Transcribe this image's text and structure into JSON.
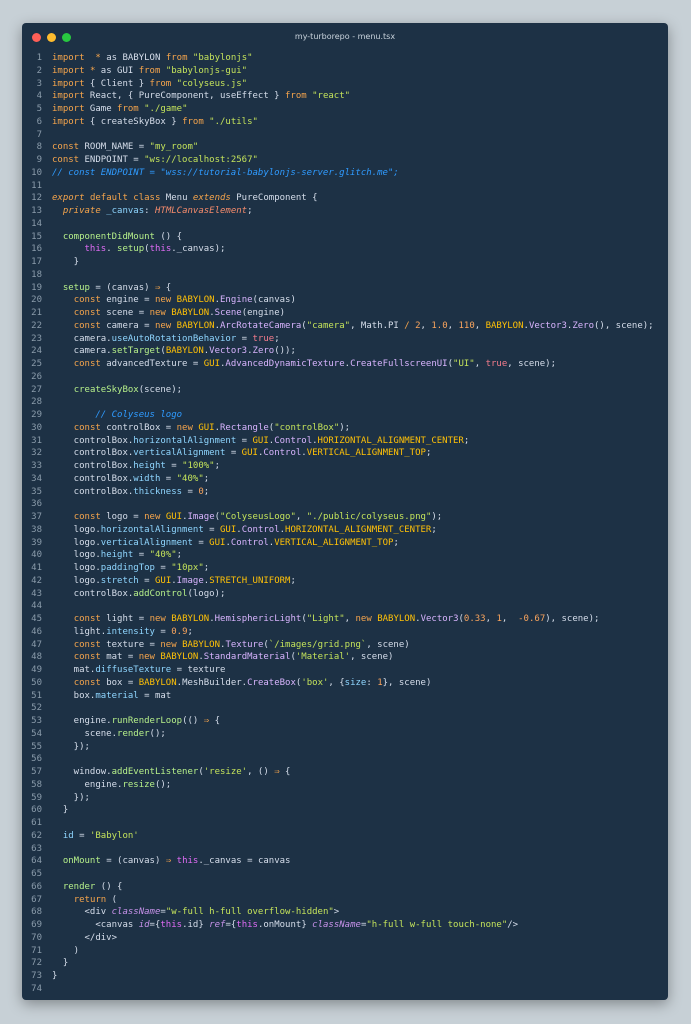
{
  "window": {
    "title": "my-turborepo - menu.tsx",
    "traffic_lights": [
      "close-button",
      "minimize-button",
      "maximize-button"
    ]
  },
  "code_lines": [
    [
      [
        "kw",
        "import"
      ],
      [
        "",
        "  "
      ],
      [
        "kw",
        "*"
      ],
      [
        "",
        " as BABYLON "
      ],
      [
        "kw",
        "from"
      ],
      [
        "",
        " "
      ],
      [
        "str",
        "\"babylonjs\""
      ]
    ],
    [
      [
        "kw",
        "import"
      ],
      [
        "",
        " "
      ],
      [
        "kw",
        "*"
      ],
      [
        "",
        " as GUI "
      ],
      [
        "kw",
        "from"
      ],
      [
        "",
        " "
      ],
      [
        "str",
        "\"babylonjs-gui\""
      ]
    ],
    [
      [
        "kw",
        "import"
      ],
      [
        "",
        " { Client } "
      ],
      [
        "kw",
        "from"
      ],
      [
        "",
        " "
      ],
      [
        "str",
        "\"colyseus.js\""
      ]
    ],
    [
      [
        "kw",
        "import"
      ],
      [
        "",
        " React, { PureComponent, useEffect } "
      ],
      [
        "kw",
        "from"
      ],
      [
        "",
        " "
      ],
      [
        "str",
        "\"react\""
      ]
    ],
    [
      [
        "kw",
        "import"
      ],
      [
        "",
        " Game "
      ],
      [
        "kw",
        "from"
      ],
      [
        "",
        " "
      ],
      [
        "str",
        "\"./game\""
      ]
    ],
    [
      [
        "kw",
        "import"
      ],
      [
        "",
        " { createSkyBox } "
      ],
      [
        "kw",
        "from"
      ],
      [
        "",
        " "
      ],
      [
        "str",
        "\"./utils\""
      ]
    ],
    [],
    [
      [
        "kw",
        "const"
      ],
      [
        "",
        " ROOM_NAME = "
      ],
      [
        "str",
        "\"my_room\""
      ]
    ],
    [
      [
        "kw",
        "const"
      ],
      [
        "",
        " ENDPOINT = "
      ],
      [
        "str",
        "\"ws://localhost:2567\""
      ]
    ],
    [
      [
        "cm",
        "// const ENDPOINT = \"wss://tutorial-babylonjs-server.glitch.me\";"
      ]
    ],
    [],
    [
      [
        "kwi",
        "export"
      ],
      [
        "",
        " "
      ],
      [
        "kw",
        "default"
      ],
      [
        "",
        " "
      ],
      [
        "kw",
        "class"
      ],
      [
        "",
        " Menu "
      ],
      [
        "kwi",
        "extends"
      ],
      [
        "",
        " PureComponent {"
      ]
    ],
    [
      [
        "",
        "  "
      ],
      [
        "kwi",
        "private"
      ],
      [
        "",
        " "
      ],
      [
        "prop",
        "_canvas"
      ],
      [
        "",
        ": "
      ],
      [
        "ty",
        "HTMLCanvasElement"
      ],
      [
        "",
        ";"
      ]
    ],
    [],
    [
      [
        "",
        "  "
      ],
      [
        "mth",
        "componentDidMount"
      ],
      [
        "",
        " () {"
      ]
    ],
    [
      [
        "",
        "      "
      ],
      [
        "this",
        "this"
      ],
      [
        "",
        ". "
      ],
      [
        "mth",
        "setup"
      ],
      [
        "",
        "("
      ],
      [
        "this",
        "this"
      ],
      [
        "",
        "._canvas);"
      ]
    ],
    [
      [
        "",
        "    }"
      ]
    ],
    [],
    [
      [
        "",
        "  "
      ],
      [
        "mth",
        "setup"
      ],
      [
        "",
        " = (canvas) "
      ],
      [
        "kw",
        "⇒"
      ],
      [
        "",
        " {"
      ]
    ],
    [
      [
        "",
        "    "
      ],
      [
        "kw",
        "const"
      ],
      [
        "",
        " engine = "
      ],
      [
        "kw",
        "new"
      ],
      [
        "",
        " "
      ],
      [
        "cls",
        "BABYLON"
      ],
      [
        "",
        "."
      ],
      [
        "fn",
        "Engine"
      ],
      [
        "",
        "(canvas)"
      ]
    ],
    [
      [
        "",
        "    "
      ],
      [
        "kw",
        "const"
      ],
      [
        "",
        " scene = "
      ],
      [
        "kw",
        "new"
      ],
      [
        "",
        " "
      ],
      [
        "cls",
        "BABYLON"
      ],
      [
        "",
        "."
      ],
      [
        "fn",
        "Scene"
      ],
      [
        "",
        "(engine)"
      ]
    ],
    [
      [
        "",
        "    "
      ],
      [
        "kw",
        "const"
      ],
      [
        "",
        " camera = "
      ],
      [
        "kw",
        "new"
      ],
      [
        "",
        " "
      ],
      [
        "cls",
        "BABYLON"
      ],
      [
        "",
        "."
      ],
      [
        "fn",
        "ArcRotateCamera"
      ],
      [
        "",
        "("
      ],
      [
        "str",
        "\"camera\""
      ],
      [
        "",
        ", Math.PI "
      ],
      [
        "kw",
        "/"
      ],
      [
        "",
        " "
      ],
      [
        "num",
        "2"
      ],
      [
        "",
        ", "
      ],
      [
        "num",
        "1.0"
      ],
      [
        "",
        ", "
      ],
      [
        "num",
        "110"
      ],
      [
        "",
        ", "
      ],
      [
        "cls",
        "BABYLON"
      ],
      [
        "",
        "."
      ],
      [
        "fn",
        "Vector3"
      ],
      [
        "",
        "."
      ],
      [
        "fn",
        "Zero"
      ],
      [
        "",
        "(), scene);"
      ]
    ],
    [
      [
        "",
        "    camera."
      ],
      [
        "prop",
        "useAutoRotationBehavior"
      ],
      [
        "",
        " = "
      ],
      [
        "bool",
        "true"
      ],
      [
        "",
        ";"
      ]
    ],
    [
      [
        "",
        "    camera."
      ],
      [
        "mth",
        "setTarget"
      ],
      [
        "",
        "("
      ],
      [
        "cls",
        "BABYLON"
      ],
      [
        "",
        "."
      ],
      [
        "fn",
        "Vector3"
      ],
      [
        "",
        "."
      ],
      [
        "fn",
        "Zero"
      ],
      [
        "",
        "());"
      ]
    ],
    [
      [
        "",
        "    "
      ],
      [
        "kw",
        "const"
      ],
      [
        "",
        " advancedTexture = "
      ],
      [
        "cls",
        "GUI"
      ],
      [
        "",
        "."
      ],
      [
        "fn",
        "AdvancedDynamicTexture"
      ],
      [
        "",
        "."
      ],
      [
        "fn",
        "CreateFullscreenUI"
      ],
      [
        "",
        "("
      ],
      [
        "str",
        "\"UI\""
      ],
      [
        "",
        ", "
      ],
      [
        "bool",
        "true"
      ],
      [
        "",
        ", scene);"
      ]
    ],
    [],
    [
      [
        "",
        "    "
      ],
      [
        "mth",
        "createSkyBox"
      ],
      [
        "",
        "(scene);"
      ]
    ],
    [],
    [
      [
        "",
        "        "
      ],
      [
        "cm",
        "// Colyseus logo"
      ]
    ],
    [
      [
        "",
        "    "
      ],
      [
        "kw",
        "const"
      ],
      [
        "",
        " controlBox = "
      ],
      [
        "kw",
        "new"
      ],
      [
        "",
        " "
      ],
      [
        "cls",
        "GUI"
      ],
      [
        "",
        "."
      ],
      [
        "fn",
        "Rectangle"
      ],
      [
        "",
        "("
      ],
      [
        "str",
        "\"controlBox\""
      ],
      [
        "",
        ");"
      ]
    ],
    [
      [
        "",
        "    controlBox."
      ],
      [
        "prop",
        "horizontalAlignment"
      ],
      [
        "",
        " = "
      ],
      [
        "cls",
        "GUI"
      ],
      [
        "",
        "."
      ],
      [
        "fn",
        "Control"
      ],
      [
        "",
        "."
      ],
      [
        "cls",
        "HORIZONTAL_ALIGNMENT_CENTER"
      ],
      [
        "",
        ";"
      ]
    ],
    [
      [
        "",
        "    controlBox."
      ],
      [
        "prop",
        "verticalAlignment"
      ],
      [
        "",
        " = "
      ],
      [
        "cls",
        "GUI"
      ],
      [
        "",
        "."
      ],
      [
        "fn",
        "Control"
      ],
      [
        "",
        "."
      ],
      [
        "cls",
        "VERTICAL_ALIGNMENT_TOP"
      ],
      [
        "",
        ";"
      ]
    ],
    [
      [
        "",
        "    controlBox."
      ],
      [
        "prop",
        "height"
      ],
      [
        "",
        " = "
      ],
      [
        "str",
        "\"100%\""
      ],
      [
        "",
        ";"
      ]
    ],
    [
      [
        "",
        "    controlBox."
      ],
      [
        "prop",
        "width"
      ],
      [
        "",
        " = "
      ],
      [
        "str",
        "\"40%\""
      ],
      [
        "",
        ";"
      ]
    ],
    [
      [
        "",
        "    controlBox."
      ],
      [
        "prop",
        "thickness"
      ],
      [
        "",
        " = "
      ],
      [
        "num",
        "0"
      ],
      [
        "",
        ";"
      ]
    ],
    [],
    [
      [
        "",
        "    "
      ],
      [
        "kw",
        "const"
      ],
      [
        "",
        " logo = "
      ],
      [
        "kw",
        "new"
      ],
      [
        "",
        " "
      ],
      [
        "cls",
        "GUI"
      ],
      [
        "",
        "."
      ],
      [
        "fn",
        "Image"
      ],
      [
        "",
        "("
      ],
      [
        "str",
        "\"ColyseusLogo\""
      ],
      [
        "",
        ", "
      ],
      [
        "str",
        "\"./public/colyseus.png\""
      ],
      [
        "",
        ");"
      ]
    ],
    [
      [
        "",
        "    logo."
      ],
      [
        "prop",
        "horizontalAlignment"
      ],
      [
        "",
        " = "
      ],
      [
        "cls",
        "GUI"
      ],
      [
        "",
        "."
      ],
      [
        "fn",
        "Control"
      ],
      [
        "",
        "."
      ],
      [
        "cls",
        "HORIZONTAL_ALIGNMENT_CENTER"
      ],
      [
        "",
        ";"
      ]
    ],
    [
      [
        "",
        "    logo."
      ],
      [
        "prop",
        "verticalAlignment"
      ],
      [
        "",
        " = "
      ],
      [
        "cls",
        "GUI"
      ],
      [
        "",
        "."
      ],
      [
        "fn",
        "Control"
      ],
      [
        "",
        "."
      ],
      [
        "cls",
        "VERTICAL_ALIGNMENT_TOP"
      ],
      [
        "",
        ";"
      ]
    ],
    [
      [
        "",
        "    logo."
      ],
      [
        "prop",
        "height"
      ],
      [
        "",
        " = "
      ],
      [
        "str",
        "\"40%\""
      ],
      [
        "",
        ";"
      ]
    ],
    [
      [
        "",
        "    logo."
      ],
      [
        "prop",
        "paddingTop"
      ],
      [
        "",
        " = "
      ],
      [
        "str",
        "\"10px\""
      ],
      [
        "",
        ";"
      ]
    ],
    [
      [
        "",
        "    logo."
      ],
      [
        "prop",
        "stretch"
      ],
      [
        "",
        " = "
      ],
      [
        "cls",
        "GUI"
      ],
      [
        "",
        "."
      ],
      [
        "fn",
        "Image"
      ],
      [
        "",
        "."
      ],
      [
        "cls",
        "STRETCH_UNIFORM"
      ],
      [
        "",
        ";"
      ]
    ],
    [
      [
        "",
        "    controlBox."
      ],
      [
        "mth",
        "addControl"
      ],
      [
        "",
        "(logo);"
      ]
    ],
    [],
    [
      [
        "",
        "    "
      ],
      [
        "kw",
        "const"
      ],
      [
        "",
        " light = "
      ],
      [
        "kw",
        "new"
      ],
      [
        "",
        " "
      ],
      [
        "cls",
        "BABYLON"
      ],
      [
        "",
        "."
      ],
      [
        "fn",
        "HemisphericLight"
      ],
      [
        "",
        "("
      ],
      [
        "str",
        "\"Light\""
      ],
      [
        "",
        ", "
      ],
      [
        "kw",
        "new"
      ],
      [
        "",
        " "
      ],
      [
        "cls",
        "BABYLON"
      ],
      [
        "",
        "."
      ],
      [
        "fn",
        "Vector3"
      ],
      [
        "",
        "("
      ],
      [
        "num",
        "0.33"
      ],
      [
        "",
        ", "
      ],
      [
        "num",
        "1"
      ],
      [
        "",
        ",  "
      ],
      [
        "num",
        "-0.67"
      ],
      [
        "",
        "), scene);"
      ]
    ],
    [
      [
        "",
        "    light."
      ],
      [
        "prop",
        "intensity"
      ],
      [
        "",
        " = "
      ],
      [
        "num",
        "0.9"
      ],
      [
        "",
        ";"
      ]
    ],
    [
      [
        "",
        "    "
      ],
      [
        "kw",
        "const"
      ],
      [
        "",
        " texture = "
      ],
      [
        "kw",
        "new"
      ],
      [
        "",
        " "
      ],
      [
        "cls",
        "BABYLON"
      ],
      [
        "",
        "."
      ],
      [
        "fn",
        "Texture"
      ],
      [
        "",
        "("
      ],
      [
        "str",
        "`/images/grid.png`"
      ],
      [
        "",
        ", scene)"
      ]
    ],
    [
      [
        "",
        "    "
      ],
      [
        "kw",
        "const"
      ],
      [
        "",
        " mat = "
      ],
      [
        "kw",
        "new"
      ],
      [
        "",
        " "
      ],
      [
        "cls",
        "BABYLON"
      ],
      [
        "",
        "."
      ],
      [
        "fn",
        "StandardMaterial"
      ],
      [
        "",
        "("
      ],
      [
        "str",
        "'Material'"
      ],
      [
        "",
        ", scene)"
      ]
    ],
    [
      [
        "",
        "    mat."
      ],
      [
        "prop",
        "diffuseTexture"
      ],
      [
        "",
        " = texture"
      ]
    ],
    [
      [
        "",
        "    "
      ],
      [
        "kw",
        "const"
      ],
      [
        "",
        " box = "
      ],
      [
        "cls",
        "BABYLON"
      ],
      [
        "",
        ".MeshBuilder."
      ],
      [
        "fn",
        "CreateBox"
      ],
      [
        "",
        "("
      ],
      [
        "str",
        "'box'"
      ],
      [
        "",
        ", {"
      ],
      [
        "prop",
        "size"
      ],
      [
        "",
        ": "
      ],
      [
        "num",
        "1"
      ],
      [
        "",
        "}, scene)"
      ]
    ],
    [
      [
        "",
        "    box."
      ],
      [
        "prop",
        "material"
      ],
      [
        "",
        " = mat"
      ]
    ],
    [],
    [
      [
        "",
        "    engine."
      ],
      [
        "mth",
        "runRenderLoop"
      ],
      [
        "",
        "(() "
      ],
      [
        "kw",
        "⇒"
      ],
      [
        "",
        " {"
      ]
    ],
    [
      [
        "",
        "      scene."
      ],
      [
        "mth",
        "render"
      ],
      [
        "",
        "();"
      ]
    ],
    [
      [
        "",
        "    });"
      ]
    ],
    [],
    [
      [
        "",
        "    window."
      ],
      [
        "mth",
        "addEventListener"
      ],
      [
        "",
        "("
      ],
      [
        "str",
        "'resize'"
      ],
      [
        "",
        ", () "
      ],
      [
        "kw",
        "⇒"
      ],
      [
        "",
        " {"
      ]
    ],
    [
      [
        "",
        "      engine."
      ],
      [
        "mth",
        "resize"
      ],
      [
        "",
        "();"
      ]
    ],
    [
      [
        "",
        "    });"
      ]
    ],
    [
      [
        "",
        "  }"
      ]
    ],
    [],
    [
      [
        "",
        "  "
      ],
      [
        "prop",
        "id"
      ],
      [
        "",
        " = "
      ],
      [
        "str",
        "'Babylon'"
      ]
    ],
    [],
    [
      [
        "",
        "  "
      ],
      [
        "mth",
        "onMount"
      ],
      [
        "",
        " = (canvas) "
      ],
      [
        "kw",
        "⇒"
      ],
      [
        "",
        " "
      ],
      [
        "this",
        "this"
      ],
      [
        "",
        "._canvas = canvas"
      ]
    ],
    [],
    [
      [
        "",
        "  "
      ],
      [
        "mth",
        "render"
      ],
      [
        "",
        " () {"
      ]
    ],
    [
      [
        "",
        "    "
      ],
      [
        "kw",
        "return"
      ],
      [
        "",
        " ("
      ]
    ],
    [
      [
        "",
        "      <div "
      ],
      [
        "attr",
        "className"
      ],
      [
        "",
        "="
      ],
      [
        "str",
        "\"w-full h-full overflow-hidden\""
      ],
      [
        "",
        ">"
      ]
    ],
    [
      [
        "",
        "        <canvas "
      ],
      [
        "attr",
        "id"
      ],
      [
        "",
        "={"
      ],
      [
        "this",
        "this"
      ],
      [
        "",
        ".id} "
      ],
      [
        "attr",
        "ref"
      ],
      [
        "",
        "={"
      ],
      [
        "this",
        "this"
      ],
      [
        "",
        ".onMount} "
      ],
      [
        "attr",
        "className"
      ],
      [
        "",
        "="
      ],
      [
        "str",
        "\"h-full w-full touch-none\""
      ],
      [
        "",
        "/>"
      ]
    ],
    [
      [
        "",
        "      </div>"
      ]
    ],
    [
      [
        "",
        "    )"
      ]
    ],
    [
      [
        "",
        "  }"
      ]
    ],
    [
      [
        "",
        "}"
      ]
    ],
    []
  ]
}
